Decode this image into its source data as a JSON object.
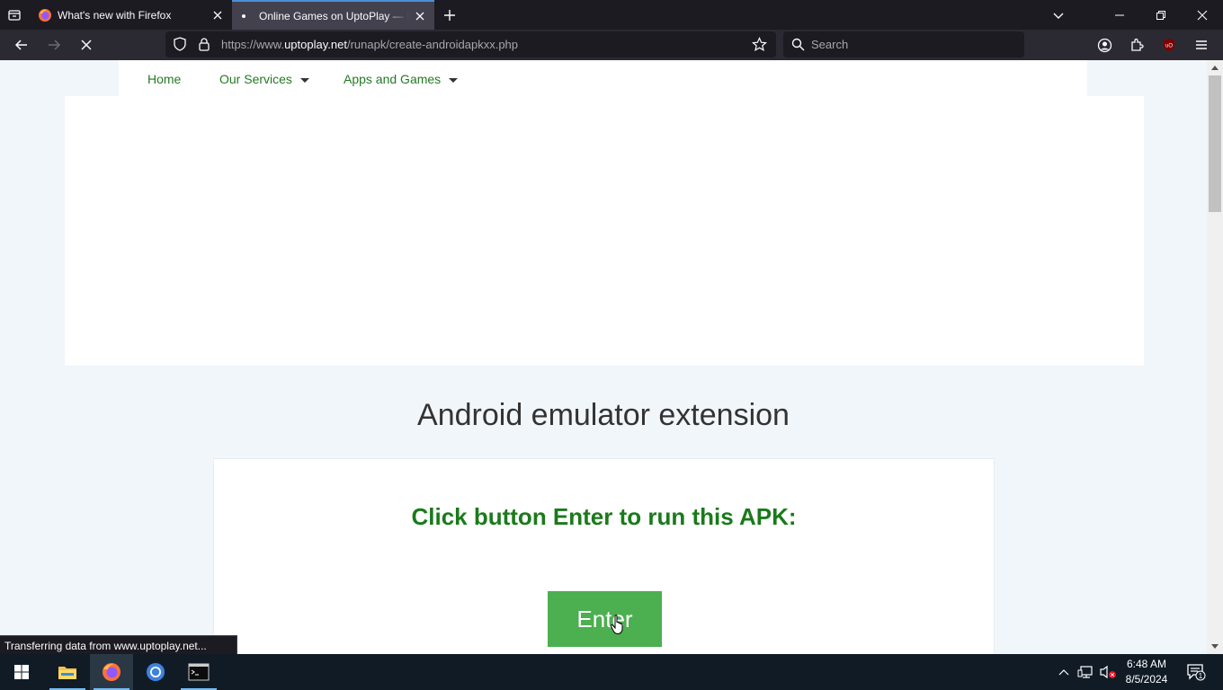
{
  "browser": {
    "tabs": [
      {
        "title": "What's new with Firefox",
        "active": false
      },
      {
        "title": "Online Games on UptoPlay — Run",
        "active": true
      }
    ],
    "url_prefix": "https://www.",
    "url_domain": "uptoplay.net",
    "url_path": "/runapk/create-androidapkxx.php",
    "search_placeholder": "Search",
    "status_text": "Transferring data from www.uptoplay.net..."
  },
  "site_nav": {
    "items": [
      {
        "label": "Home"
      },
      {
        "label": "Our Services"
      },
      {
        "label": "Apps and Games"
      }
    ]
  },
  "main": {
    "heading": "Android emulator extension",
    "message": "Click button Enter to run this APK:",
    "enter_label": "Enter"
  },
  "taskbar": {
    "time": "6:48 AM",
    "date": "8/5/2024",
    "notification_count": "1"
  },
  "colors": {
    "link_green": "#237a23",
    "message_green": "#1a7a1a",
    "button_green": "#4caf50",
    "accent_blue": "#4a90d9"
  }
}
